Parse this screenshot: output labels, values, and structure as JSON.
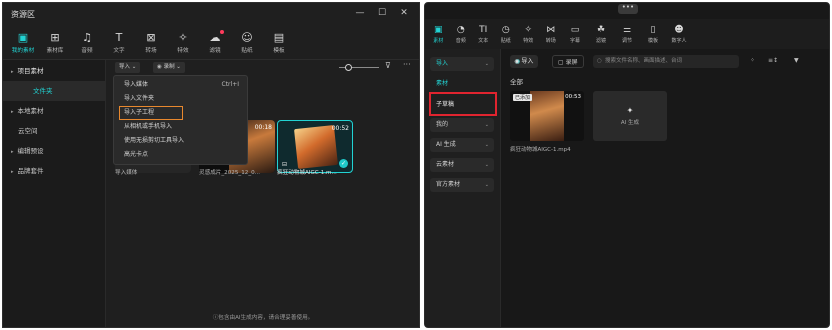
{
  "left_window": {
    "title": "资源区",
    "window_controls": {
      "minimize": "—",
      "maximize": "☐",
      "close": "✕"
    },
    "toolbar": [
      {
        "label": "我的素材",
        "icon": "media-icon",
        "glyph": "▣",
        "active": true
      },
      {
        "label": "素材库",
        "icon": "library-icon",
        "glyph": "⊞"
      },
      {
        "label": "音频",
        "icon": "audio-icon",
        "glyph": "♫"
      },
      {
        "label": "文字",
        "icon": "text-icon",
        "glyph": "T"
      },
      {
        "label": "转场",
        "icon": "transition-icon",
        "glyph": "⊠"
      },
      {
        "label": "特效",
        "icon": "effects-icon",
        "glyph": "✧"
      },
      {
        "label": "滤镜",
        "icon": "filter-icon",
        "glyph": "☁",
        "badge": true
      },
      {
        "label": "贴纸",
        "icon": "sticker-icon",
        "glyph": "☺"
      },
      {
        "label": "模板",
        "icon": "template-icon",
        "glyph": "▤"
      }
    ],
    "sidebar": [
      {
        "label": "项目素材",
        "caret": "▸"
      },
      {
        "label": "文件夹",
        "active": true
      },
      {
        "label": "本地素材",
        "caret": "▸"
      },
      {
        "label": "云空间"
      },
      {
        "label": "编辑预设",
        "caret": "▸"
      },
      {
        "label": "品牌套件",
        "caret": "▸"
      }
    ],
    "filters": {
      "import_label": "导入 ⌄",
      "record_label": "录制 ⌄"
    },
    "dropdown": [
      {
        "label": "导入媒体",
        "shortcut": "Ctrl+I"
      },
      {
        "label": "导入文件夹"
      },
      {
        "label": "导入子工程",
        "highlighted": true
      },
      {
        "label": "从相机或手机导入"
      },
      {
        "label": "使用无损剪切工具导入"
      },
      {
        "label": "高光卡点"
      }
    ],
    "media": [
      {
        "name": "导入媒体"
      },
      {
        "name": "灵感成片_2025_12_0...",
        "duration": "00:18"
      },
      {
        "name": "疯狂动物城AIGC-1.m...",
        "duration": "00:52",
        "selected": true
      }
    ],
    "footnote": "ⓘ包含由AI生成内容，请合理妥善使用。"
  },
  "right_window": {
    "grip": "•••",
    "toolbar": [
      {
        "label": "素材",
        "icon": "media-icon",
        "glyph": "▣",
        "active": true
      },
      {
        "label": "音频",
        "icon": "audio-icon",
        "glyph": "◔"
      },
      {
        "label": "文本",
        "icon": "text-icon",
        "glyph": "TI"
      },
      {
        "label": "贴纸",
        "icon": "sticker-icon",
        "glyph": "◷"
      },
      {
        "label": "特效",
        "icon": "effects-icon",
        "glyph": "✧"
      },
      {
        "label": "转场",
        "icon": "transition-icon",
        "glyph": "⋈"
      },
      {
        "label": "字幕",
        "icon": "caption-icon",
        "glyph": "▭"
      },
      {
        "label": "滤镜",
        "icon": "filter-icon",
        "glyph": "☘"
      },
      {
        "label": "调节",
        "icon": "adjust-icon",
        "glyph": "⚌"
      },
      {
        "label": "模板",
        "icon": "template-icon",
        "glyph": "▯"
      },
      {
        "label": "数字人",
        "icon": "avatar-icon",
        "glyph": "☻"
      }
    ],
    "sidebar": {
      "import": "导入",
      "material": "素材",
      "subproject": "子草稿",
      "mine": "我的",
      "ai_gen": "AI 生成",
      "cloud": "云素材",
      "official": "官方素材"
    },
    "buttons": {
      "import": "◉ 导入",
      "record": "▢ 录屏"
    },
    "search_placeholder": "搜索文件名称、画面描述、台词",
    "view_controls": {
      "grid": "⁘",
      "sort": "≡↕",
      "filter": "▼"
    },
    "heading": "全部",
    "media": [
      {
        "name": "疯狂动物城AIGC-1.mp4",
        "badge": "已添加",
        "duration": "00:53"
      }
    ],
    "ai_tile_label": "AI 生成"
  }
}
